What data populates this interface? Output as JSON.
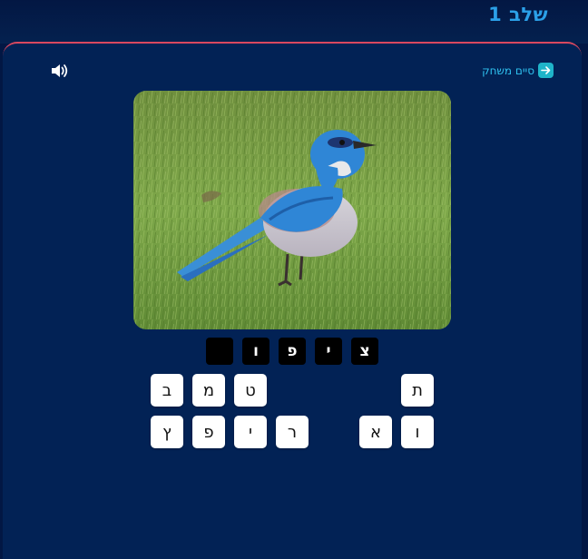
{
  "header": {
    "level_title": "שלב 1"
  },
  "toolbar": {
    "end_game_label": "סיים משחק",
    "sound_icon": "speaker-icon",
    "end_game_icon": "arrow-right-icon"
  },
  "answer": {
    "slots": [
      "",
      "ו",
      "פ",
      "י",
      "צ"
    ]
  },
  "letter_bank": {
    "row1": [
      "ב",
      "מ",
      "ט",
      "",
      "",
      "",
      "ת"
    ],
    "row2": [
      "ץ",
      "פ",
      "י",
      "ר",
      "",
      "א",
      "ו"
    ]
  },
  "colors": {
    "background": "#021744",
    "panel": "#022255",
    "accent_border": "#d9485f",
    "title": "#2ba0e8",
    "link": "#2fc2f0"
  }
}
